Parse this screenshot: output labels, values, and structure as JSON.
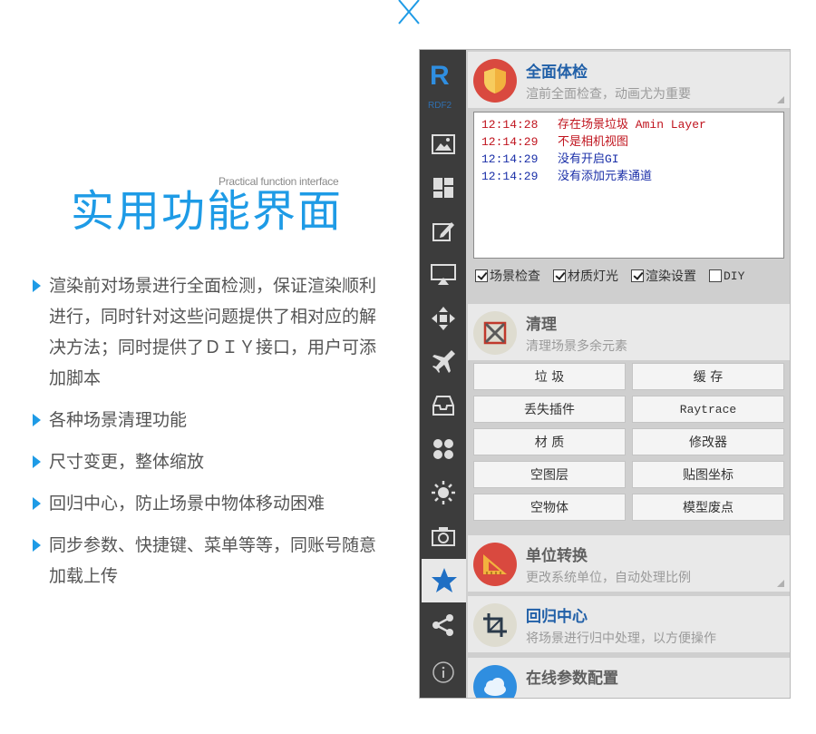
{
  "promo": {
    "subtitle_en": "Practical function interface",
    "title_cn": "实用功能界面",
    "features": [
      "渲染前对场景进行全面检测，保证渲染顺利进行，同时针对这些问题提供了相对应的解决方法；同时提供了ＤＩＹ接口，用户可添加脚本",
      "各种场景清理功能",
      "尺寸变更，整体缩放",
      "回归中心，防止场景中物体移动困难",
      "同步参数、快捷键、菜单等等，同账号随意加载上传"
    ]
  },
  "sidebar": {
    "logo": "R",
    "logo_sub": "RDF2",
    "icons": [
      "image-icon",
      "layout-icon",
      "edit-icon",
      "screen-icon",
      "move-icon",
      "plane-icon",
      "inbox-icon",
      "grid-dots-icon",
      "sun-icon",
      "camera-icon",
      "star-icon",
      "share-icon",
      "info-icon"
    ],
    "active": "star-icon"
  },
  "sections": {
    "checkup": {
      "title": "全面体检",
      "desc": "渲前全面检查，动画尤为重要",
      "log": [
        {
          "time": "12:14:28",
          "msg": "存在场景垃圾 Amin Layer",
          "color": "red"
        },
        {
          "time": "12:14:29",
          "msg": "不是相机视图",
          "color": "red"
        },
        {
          "time": "12:14:29",
          "msg": "没有开启GI",
          "color": "blue"
        },
        {
          "time": "12:14:29",
          "msg": "没有添加元素通道",
          "color": "blue"
        }
      ],
      "checks": [
        {
          "label": "场景检查",
          "checked": true
        },
        {
          "label": "材质灯光",
          "checked": true
        },
        {
          "label": "渲染设置",
          "checked": true
        },
        {
          "label": "DIY",
          "checked": false
        }
      ]
    },
    "clean": {
      "title": "清理",
      "desc": "清理场景多余元素",
      "buttons": [
        "垃 圾",
        "缓 存",
        "丢失插件",
        "Raytrace",
        "材 质",
        "修改器",
        "空图层",
        "贴图坐标",
        "空物体",
        "模型废点"
      ]
    },
    "unit": {
      "title": "单位转换",
      "desc": "更改系统单位，自动处理比例"
    },
    "center": {
      "title": "回归中心",
      "desc": "将场景进行归中处理，以方便操作"
    },
    "online": {
      "title": "在线参数配置"
    }
  },
  "colors": {
    "accent": "#1e9be6",
    "panel_bg": "#cfcfcf",
    "sidebar_bg": "#3c3c3c",
    "section_title": "#2160a8",
    "log_red": "#c0141e",
    "log_blue": "#1a2fa8"
  }
}
